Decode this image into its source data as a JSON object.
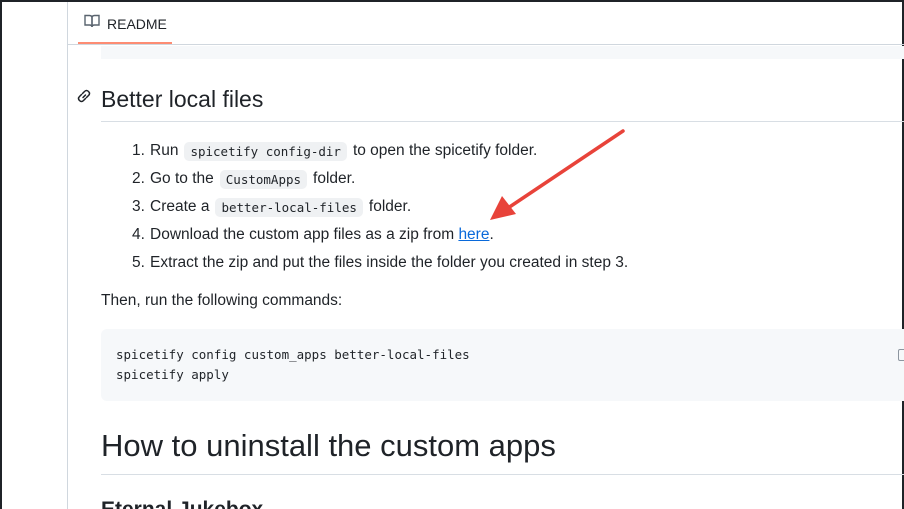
{
  "readme_tab": {
    "label": "README",
    "icon": "book-icon",
    "accent": "#fd8c73"
  },
  "section_heading": {
    "text": "Better local files",
    "icon": "link-icon"
  },
  "steps": [
    {
      "num": "1.",
      "before": "Run",
      "code": "spicetify config-dir",
      "after": "to open the spicetify folder."
    },
    {
      "num": "2.",
      "before": "Go to the",
      "code": "CustomApps",
      "after": "folder."
    },
    {
      "num": "3.",
      "before": "Create a",
      "code": "better-local-files",
      "after": "folder."
    },
    {
      "num": "4.",
      "before": "Download the custom app files as a zip from",
      "link": "here",
      "after": "."
    },
    {
      "num": "5.",
      "text": "Extract the zip and put the files inside the folder you created in step 3."
    }
  ],
  "commands_intro": "Then, run the following commands:",
  "code_block": {
    "lines": [
      "spicetify config custom_apps better-local-files",
      "spicetify apply"
    ]
  },
  "uninstall_heading": "How to uninstall the custom apps",
  "next_heading_partial": "Eternal Jukebox",
  "colors": {
    "link": "#0969da",
    "annotation_arrow": "#e8433a"
  }
}
